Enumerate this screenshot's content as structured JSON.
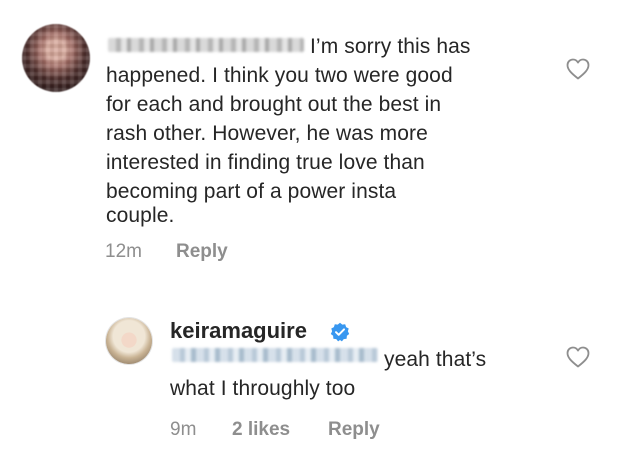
{
  "comments": [
    {
      "text_lines": [
        "I’m sorry this has",
        "happened. I think you two were good",
        "for each and brought out the best in",
        "rash other.  However, he was more",
        "interested in finding true love than",
        "becoming part of a power insta",
        "couple."
      ],
      "time": "12m",
      "reply_label": "Reply",
      "like_icon": "heart-outline-icon"
    },
    {
      "username": "keiramaguire",
      "verified_icon": "verified-badge-icon",
      "text_lines": [
        "yeah that’s",
        "what I throughly too"
      ],
      "time": "9m",
      "likes": "2 likes",
      "reply_label": "Reply",
      "like_icon": "heart-outline-icon"
    }
  ],
  "colors": {
    "text": "#262626",
    "meta": "#8e8e8e",
    "verified": "#3897f0"
  }
}
